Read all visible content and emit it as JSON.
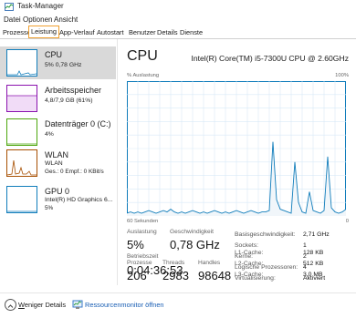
{
  "window": {
    "title": "Task-Manager"
  },
  "menu": [
    "Datei",
    "Optionen",
    "Ansicht"
  ],
  "tabs": [
    "Prozesse",
    "Leistung",
    "App-Verlauf",
    "Autostart",
    "Benutzer",
    "Details",
    "Dienste"
  ],
  "active_tab": "Leistung",
  "sidebar": [
    {
      "name": "CPU",
      "sub": "5%  0,78 GHz",
      "color": "#117dbb",
      "selected": true
    },
    {
      "name": "Arbeitsspeicher",
      "sub": "4,8/7,9 GB (61%)",
      "color": "#8b12ae",
      "fill": 0.61
    },
    {
      "name": "Datenträger 0 (C:)",
      "sub": "4%",
      "color": "#4da60c"
    },
    {
      "name": "WLAN",
      "sub": "WLAN",
      "sub2": "Ges.: 0  Empf.: 0 KBit/s",
      "color": "#a74f01"
    },
    {
      "name": "GPU 0",
      "sub": "Intel(R) HD Graphics 6...",
      "sub2": "5%",
      "color": "#117dbb"
    }
  ],
  "main": {
    "title": "CPU",
    "model": "Intel(R) Core(TM) i5-7300U CPU @ 2.60GHz",
    "graph_label": "% Auslastung",
    "graph_max": "100%",
    "graph_time": "60 Sekunden",
    "graph_zero": "0",
    "graph_color": "#117dbb",
    "stats": {
      "auslastung_label": "Auslastung",
      "auslastung": "5%",
      "geschw_label": "Geschwindigkeit",
      "geschw": "0,78 GHz",
      "prozesse_label": "Prozesse",
      "prozesse": "206",
      "threads_label": "Threads",
      "threads": "2983",
      "handles_label": "Handles",
      "handles": "98648",
      "betrieb_label": "Betriebszeit",
      "betrieb": "0:04:36:53"
    },
    "details": [
      {
        "label": "Basisgeschwindigkeit:",
        "value": "2,71 GHz"
      },
      {
        "label": "Sockets:",
        "value": "1"
      },
      {
        "label": "Kerne:",
        "value": "2"
      },
      {
        "label": "Logische Prozessoren:",
        "value": "4"
      },
      {
        "label": "Virtualisierung:",
        "value": "Aktiviert"
      },
      {
        "label": "L1-Cache:",
        "value": "128 KB"
      },
      {
        "label": "L2-Cache:",
        "value": "512 KB"
      },
      {
        "label": "L3-Cache:",
        "value": "3,0 MB"
      }
    ]
  },
  "footer": {
    "fewer": "Weniger Details",
    "monitor": "Ressourcenmonitor öffnen"
  },
  "cpu_usage_history": [
    2,
    3,
    2,
    3,
    2,
    3,
    4,
    3,
    2,
    3,
    4,
    3,
    5,
    3,
    2,
    3,
    2,
    3,
    4,
    3,
    2,
    3,
    2,
    3,
    4,
    3,
    2,
    3,
    2,
    3,
    4,
    3,
    2,
    3,
    4,
    3,
    2,
    3,
    3,
    4,
    55,
    12,
    5,
    4,
    3,
    2,
    40,
    10,
    3,
    2,
    18,
    4,
    3,
    2,
    4,
    44,
    6,
    3,
    2,
    3,
    5
  ]
}
